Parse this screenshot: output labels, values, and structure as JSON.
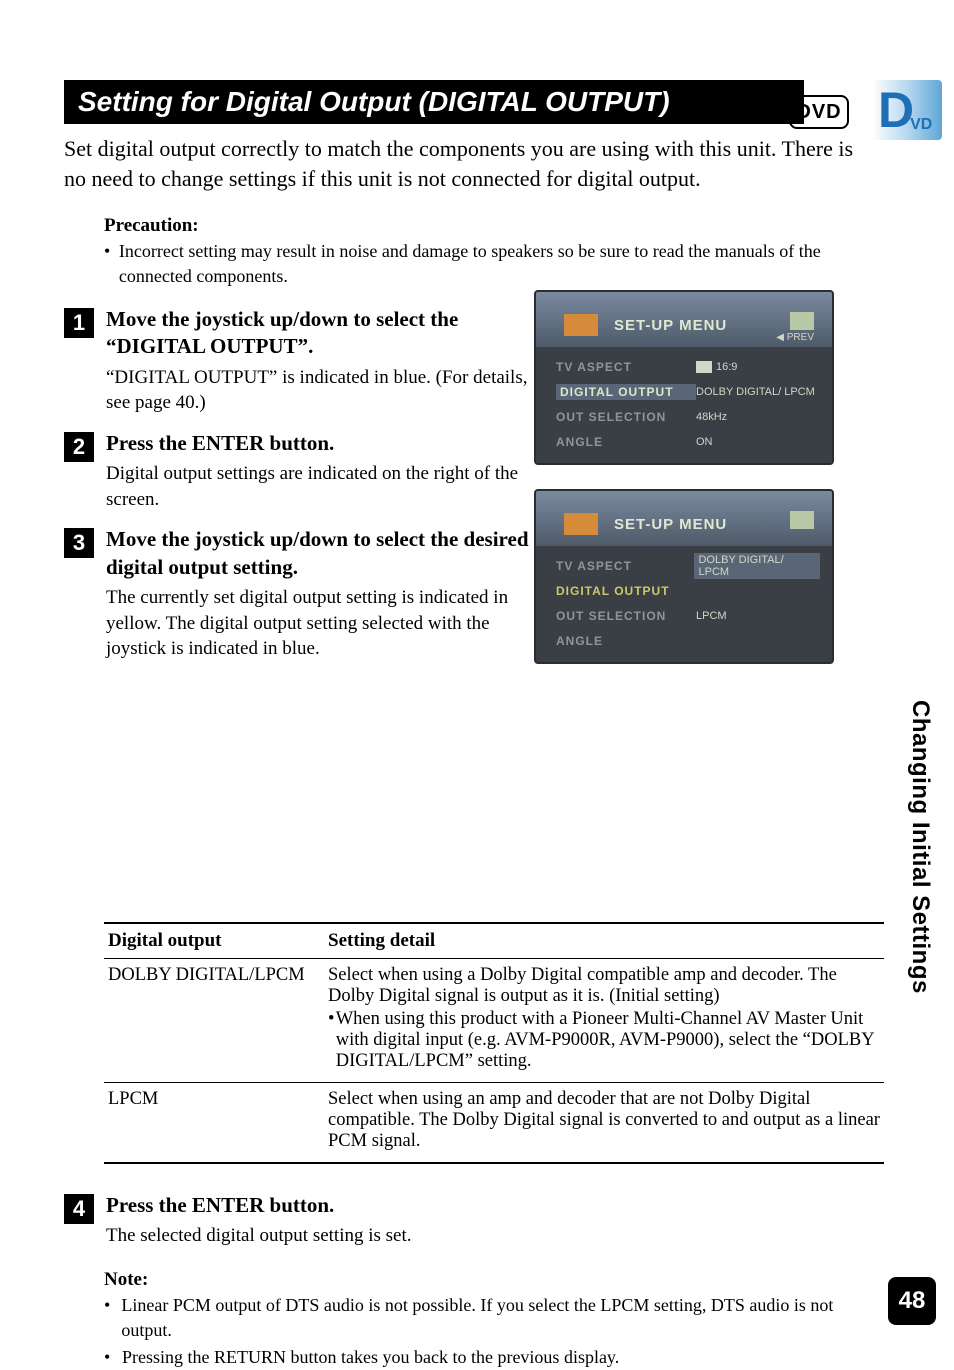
{
  "badges": {
    "dvd_bracket": "DVD",
    "side_tab_d": "D",
    "side_tab_vd": "VD"
  },
  "title": "Setting for Digital Output (DIGITAL OUTPUT)",
  "lead": "Set digital output correctly to match the components you are using with this unit. There is no need to change settings if this unit is not connected for digital output.",
  "precaution": {
    "heading": "Precaution:",
    "item": "Incorrect setting may result in noise and damage to speakers so be sure to read the manuals of the connected components."
  },
  "steps": {
    "s1": {
      "num": "1",
      "head": "Move the joystick up/down to select the “DIGITAL OUTPUT”.",
      "text": "“DIGITAL OUTPUT” is indicated in blue. (For details, see page 40.)"
    },
    "s2": {
      "num": "2",
      "head": "Press the ENTER button.",
      "text": "Digital output settings are indicated on the right of the screen."
    },
    "s3": {
      "num": "3",
      "head": "Move the joystick up/down to select the desired digital output setting.",
      "text": "The currently set digital output setting is indicated in yellow. The digital output setting selected with the joystick is indicated in blue."
    },
    "s4": {
      "num": "4",
      "head": "Press the ENTER button.",
      "text": "The selected digital output setting is set."
    }
  },
  "screenshot_a": {
    "title": "SET-UP MENU",
    "prev": "◀ PREV",
    "rows": {
      "r1_lab": "TV ASPECT",
      "r1_val": "16:9",
      "r2_lab": "DIGITAL OUTPUT",
      "r2_val": "DOLBY DIGITAL/ LPCM",
      "r3_lab": "OUT SELECTION",
      "r3_val": "48kHz",
      "r4_lab": "ANGLE",
      "r4_val": "ON"
    }
  },
  "screenshot_b": {
    "title": "SET-UP MENU",
    "rows": {
      "r1_lab": "TV ASPECT",
      "r1_val": "DOLBY DIGITAL/ LPCM",
      "r2_lab": "DIGITAL OUTPUT",
      "r3_lab": "OUT SELECTION",
      "r3_val": "LPCM",
      "r4_lab": "ANGLE"
    }
  },
  "table": {
    "h1": "Digital output",
    "h2": "Setting detail",
    "r1c1": "DOLBY DIGITAL/LPCM",
    "r1c2a": "Select when using a Dolby Digital compatible amp and decoder. The Dolby Digital signal is output as it is. (Initial setting)",
    "r1c2b": "When using this product with a Pioneer Multi-Channel AV Master Unit with digital input (e.g. AVM-P9000R, AVM-P9000), select the “DOLBY DIGITAL/LPCM” setting.",
    "r2c1": "LPCM",
    "r2c2": "Select when using an amp and decoder that are not Dolby Digital compatible. The Dolby Digital signal is converted to and output as a linear PCM signal."
  },
  "note": {
    "heading": "Note:",
    "n1": "Linear PCM output of DTS audio is not possible. If you select the LPCM setting, DTS audio is not output.",
    "n2": "Pressing the RETURN button takes you back to the previous display."
  },
  "sidebar": "Changing Initial Settings",
  "page_number": "48"
}
